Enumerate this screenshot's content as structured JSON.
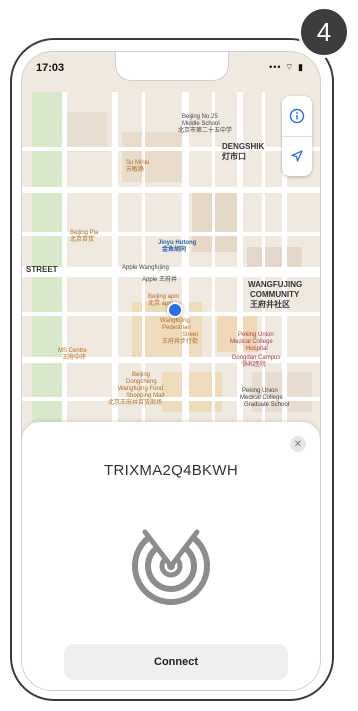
{
  "step_badge": "4",
  "status_bar": {
    "time": "17:03",
    "icons": "••• ⌔ ▮"
  },
  "map": {
    "labels": {
      "beijing_no25": "Beijing No.25",
      "middle_school": "Middle School",
      "middle_school_cn": "北京市第二十五中学",
      "dengshik": "DENGSHIK",
      "dengshik_cn": "灯市口",
      "su_minlu": "Su Minlu",
      "su_minlu_cn": "苏敏路",
      "beijing_pia": "Beijing Pia",
      "beijing_pia_cn": "北京百货",
      "jinyu_hutong": "Jinyu Hutong",
      "jinyu_hutong_cn": "金鱼胡同",
      "street": "STREET",
      "apple_wangfujing": "Apple Wangfujing",
      "apple_cn": "Apple 王府井",
      "beijing_apm": "Beijing apm",
      "beijing_apm_cn": "北京 apm",
      "wangfujing": "WANGFUJING",
      "community": "COMMUNITY",
      "community_cn": "王府井社区",
      "wangfujing_ped": "Wangfujing",
      "pedestrian": "Pedestrian",
      "street2": "Street",
      "street2_cn": "王府井步行街",
      "ms_centre": "MS Centre",
      "ms_centre_cn": "王府中环",
      "peking_union": "Peking Union",
      "medical_college": "Medical College",
      "hospital": "Hospital",
      "dongdan_campus": "Dongdan Campus",
      "hospital_cn": "协和医院",
      "beijing_dongcheng": "Beijing",
      "dongsheng": "Dongcheng",
      "wangfujing_food": "Wangfujing Food",
      "shopping_mall": "Shopping Mall",
      "shopping_mall_cn": "北京王府井百货商场",
      "peking_union2": "Peking Union",
      "medical_college2": "Medical College",
      "graduate_school": "Graduate School"
    }
  },
  "sheet": {
    "close_symbol": "✕",
    "device_name": "TRIXMA2Q4BKWH",
    "connect_label": "Connect"
  },
  "colors": {
    "accent_blue": "#2a6ee8",
    "radar_gray": "#8c8c8c",
    "button_bg": "#efefef",
    "badge_bg": "#3d3d3d"
  }
}
